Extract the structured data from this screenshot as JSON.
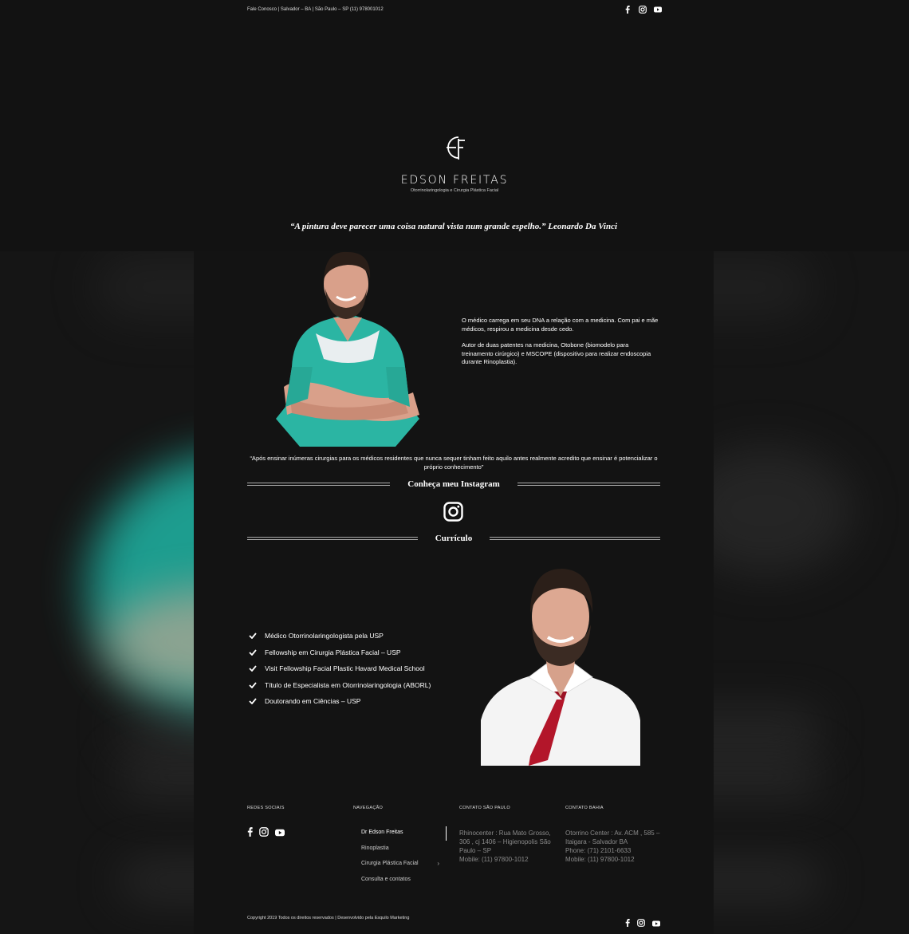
{
  "topbar": {
    "contact_text": "Fale Conosco | Salvador – BA | São Paulo – SP (11) 978001012",
    "social_icons": [
      "facebook-icon",
      "instagram-icon",
      "youtube-icon"
    ]
  },
  "brand": {
    "monogram": "EF",
    "name": "EDSON FREITAS",
    "subtitle": "Otorrinolaringologia e Cirurgia Plástica Facial"
  },
  "hero_quote": "“A pintura deve parecer uma coisa natural vista num grande espelho.”  Leonardo Da Vinci",
  "about": {
    "paragraph1": "O médico carrega em seu DNA a relação com a medicina. Com pai e mãe médicos, respirou a medicina desde cedo.",
    "paragraph2": "Autor de duas patentes na medicina, Otobone (biomodelo para treinamento cirúrgico) e MSCOPE (dispositivo para realizar endoscopia durante Rinoplastia)."
  },
  "teaching_quote": "“Após ensinar inúmeras cirurgias para os médicos residentes que nunca sequer tinham feito aquilo antes realmente acredito que ensinar é potencializar o próprio conhecimento”",
  "instagram_section": {
    "title": "Conheça meu Instagram"
  },
  "curriculum_section": {
    "title": "Currículo",
    "items": [
      "Médico Otorrinolaringologista pela USP",
      "Fellowship em Cirurgia Plástica Facial  – USP",
      "Visit Fellowship Facial Plastic Havard Medical School",
      "Título de Especialista em Otorrinolaringologia (ABORL)",
      "Doutorando em Ciências – USP"
    ]
  },
  "footer": {
    "social_heading": "REDES SOCIAIS",
    "nav_heading": "NAVEGAÇÃO",
    "nav_items": [
      "Dr Edson Freitas",
      "Rinoplastia",
      "Cirurgia Plástica Facial",
      "Consulta e contatos"
    ],
    "sp_heading": "CONTATO SÃO PAULO",
    "sp_text": "Rhinocenter : Rua Mato Grosso, 306 , cj 1406 – Higienopolis São Paulo – SP",
    "sp_mobile": "Mobile: (11) 97800-1012",
    "ba_heading": "CONTATO BAHIA",
    "ba_text": "Otorrino Center : Av. ACM , 585 – Itaigara - Salvador BA",
    "ba_phone": "Phone: (71) 2101-6633",
    "ba_mobile": "Mobile: (11) 97800-1012"
  },
  "copyright": "Copyright 2019 Todos os direitos reservados | Desenvolvido pela Esquilo Marketing",
  "colors": {
    "background": "#131313",
    "scrubs": "#2bb5a3",
    "tie": "#b3162a",
    "text": "#ffffff",
    "muted": "#8a8a8a"
  }
}
